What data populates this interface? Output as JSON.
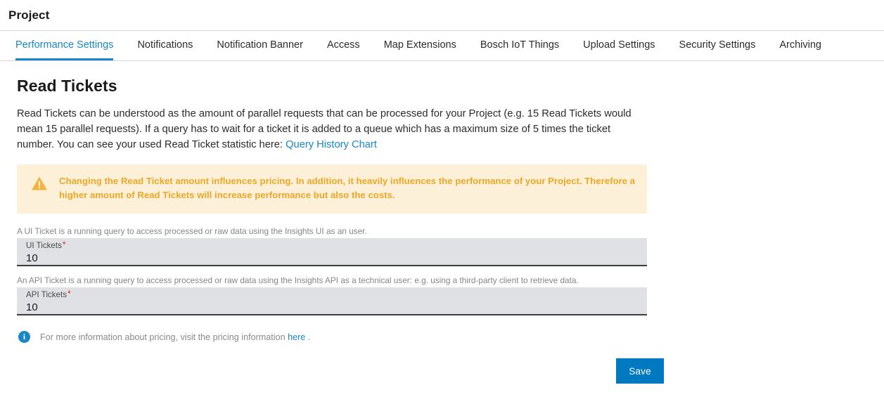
{
  "header": {
    "title": "Project"
  },
  "tabs": [
    {
      "label": "Performance Settings",
      "active": true
    },
    {
      "label": "Notifications",
      "active": false
    },
    {
      "label": "Notification Banner",
      "active": false
    },
    {
      "label": "Access",
      "active": false
    },
    {
      "label": "Map Extensions",
      "active": false
    },
    {
      "label": "Bosch IoT Things",
      "active": false
    },
    {
      "label": "Upload Settings",
      "active": false
    },
    {
      "label": "Security Settings",
      "active": false
    },
    {
      "label": "Archiving",
      "active": false
    }
  ],
  "main": {
    "page_title": "Read Tickets",
    "intro_text": "Read Tickets can be understood as the amount of parallel requests that can be processed for your Project (e.g. 15 Read Tickets would mean 15 parallel requests). If a query has to wait for a ticket it is added to a queue which has a maximum size of 5 times the ticket number. You can see your used Read Ticket statistic here: ",
    "intro_link": "Query History Chart",
    "warning": {
      "icon": "warning-triangle-icon",
      "text": "Changing the Read Ticket amount influences pricing. In addition, it heavily influences the performance of your Project. Therefore a higher amount of Read Tickets will increase performance but also the costs."
    },
    "fields": [
      {
        "help": "A UI Ticket is a running query to access processed or raw data using the Insights UI as an user.",
        "label": "UI Tickets",
        "required_marker": "*",
        "value": "10"
      },
      {
        "help": "An API Ticket is a running query to access processed or raw data using the Insights API as a technical user: e.g. using a third-party client to retrieve data.",
        "label": "API Tickets",
        "required_marker": "*",
        "value": "10"
      }
    ],
    "info": {
      "icon": "info-circle-icon",
      "glyph": "i",
      "text_before": "For more information about pricing, visit the pricing information ",
      "link": "here",
      "text_after": " ."
    },
    "save_label": "Save"
  },
  "colors": {
    "accent": "#1787c8",
    "button": "#0079c1",
    "warning_bg": "#fdf0d9",
    "warning_text": "#eda726",
    "field_bg": "#e0e1e4",
    "required": "#e02020"
  }
}
